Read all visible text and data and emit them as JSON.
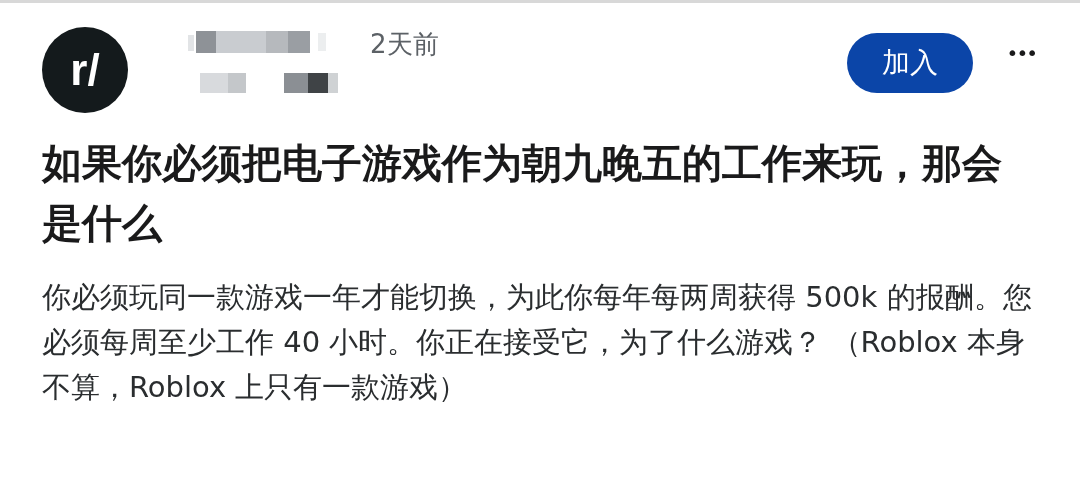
{
  "post": {
    "avatar": "r/",
    "time": "2天前",
    "join_button": "加入",
    "more_button": "•••",
    "title": "如果你必须把电子游戏作为朝九晚五的工作来玩，那会是什么",
    "body": "你必须玩同一款游戏一年才能切换，为此你每年每两周获得 500k 的报酬。您必须每周至少工作 40 小时。你正在接受它，为了什么游戏？ （Roblox 本身不算，Roblox 上只有一款游戏）"
  }
}
